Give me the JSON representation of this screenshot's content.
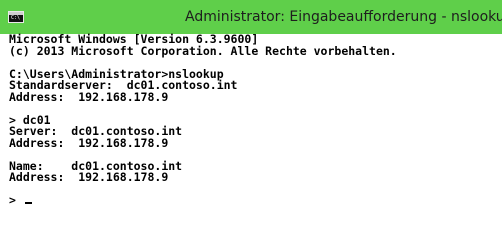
{
  "window": {
    "title": "Administrator: Eingabeaufforderung - nslookup",
    "icon": "cmd-icon",
    "icon_prompt": "C:\\",
    "titlebar_color": "#5fcf4a"
  },
  "console": {
    "lines": [
      "Microsoft Windows [Version 6.3.9600]",
      "(c) 2013 Microsoft Corporation. Alle Rechte vorbehalten.",
      "",
      "C:\\Users\\Administrator>nslookup",
      "Standardserver:  dc01.contoso.int",
      "Address:  192.168.178.9",
      "",
      "> dc01",
      "Server:  dc01.contoso.int",
      "Address:  192.168.178.9",
      "",
      "Name:    dc01.contoso.int",
      "Address:  192.168.178.9",
      "",
      "> "
    ]
  }
}
